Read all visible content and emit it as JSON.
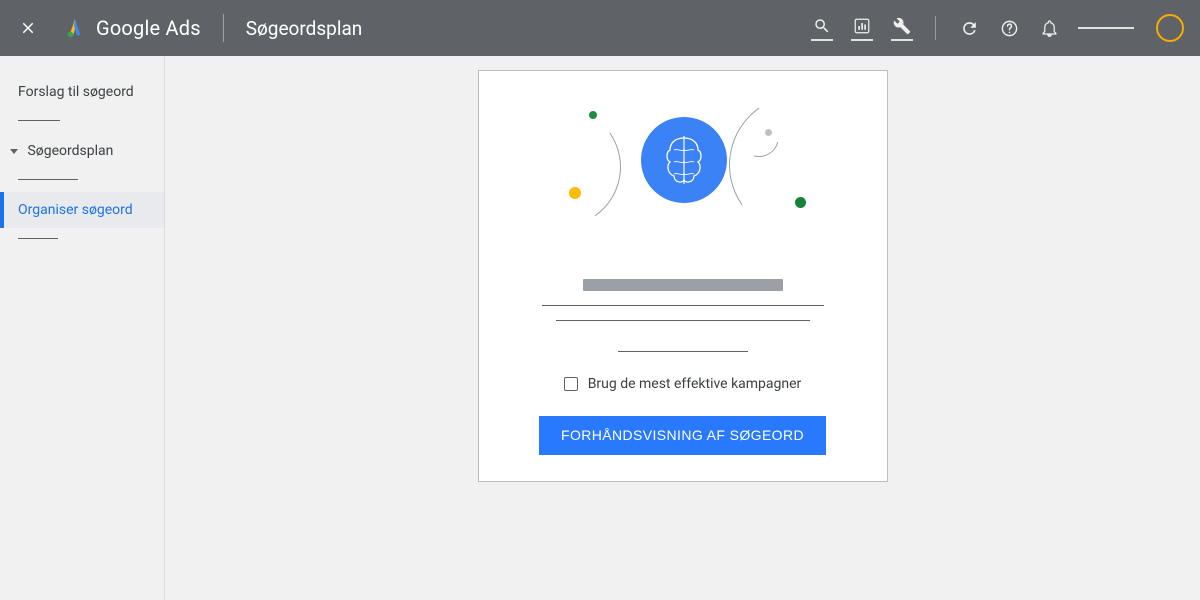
{
  "header": {
    "product": "Google Ads",
    "page_title": "Søgeordsplan"
  },
  "sidebar": {
    "items": [
      {
        "label": "Forslag til søgeord"
      },
      {
        "label": "Søgeordsplan"
      },
      {
        "label": "Organiser søgeord"
      }
    ]
  },
  "card": {
    "checkbox_label": "Brug de mest effektive kampagner",
    "cta_label": "FORHÅNDSVISNING AF SØGEORD"
  }
}
